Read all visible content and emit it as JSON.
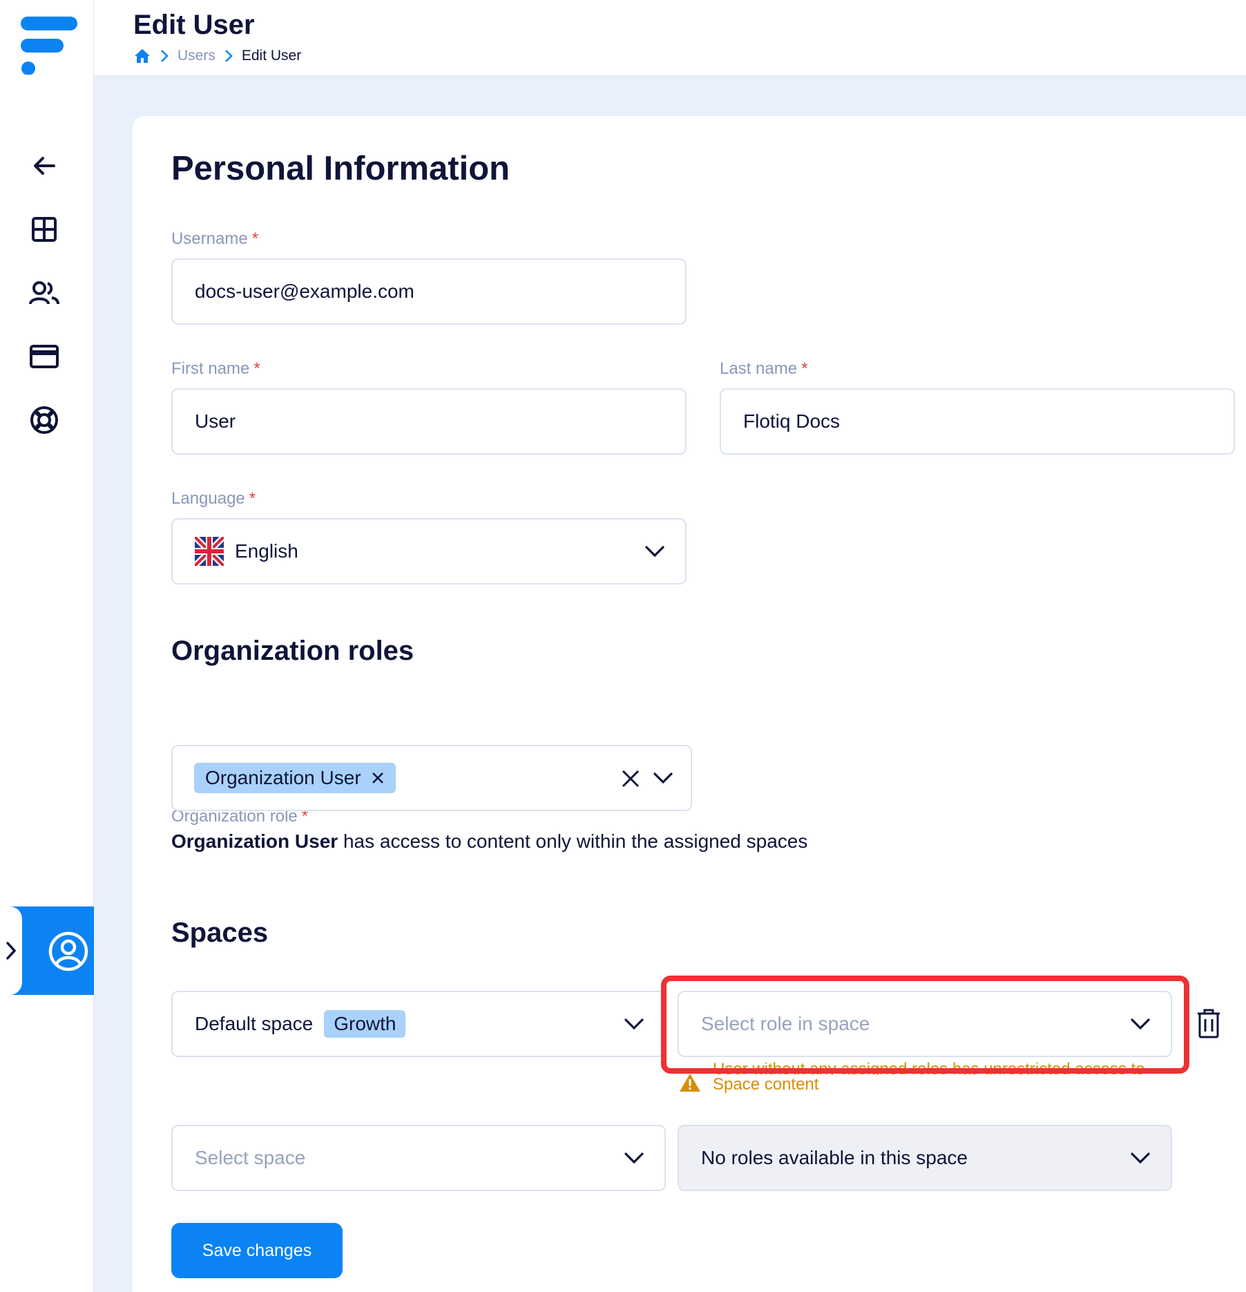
{
  "app": {
    "brand_color": "#0b83f3",
    "heading_color": "#0f1439"
  },
  "sidebar": {
    "items": [
      {
        "icon": "arrow-left-icon"
      },
      {
        "icon": "dashboard-grid-icon"
      },
      {
        "icon": "users-icon"
      },
      {
        "icon": "credit-card-icon"
      },
      {
        "icon": "lifebuoy-icon"
      }
    ],
    "user_menu_icon": "user-circle-icon"
  },
  "header": {
    "title": "Edit User",
    "breadcrumb": {
      "home_icon": "home-icon",
      "items": [
        "Users",
        "Edit User"
      ]
    }
  },
  "personal": {
    "heading": "Personal Information",
    "username": {
      "label": "Username",
      "required": "*",
      "value": "docs-user@example.com"
    },
    "first_name": {
      "label": "First name",
      "required": "*",
      "value": "User"
    },
    "last_name": {
      "label": "Last name",
      "required": "*",
      "value": "Flotiq Docs"
    },
    "language": {
      "label": "Language",
      "required": "*",
      "value": "English",
      "flag_icon": "uk-flag-icon"
    }
  },
  "org_roles": {
    "heading": "Organization roles",
    "role_field": {
      "label": "Organization role",
      "required": "*",
      "selected_tag": "Organization User"
    },
    "description_bold": "Organization User",
    "description_rest": " has access to content only within the assigned spaces"
  },
  "spaces": {
    "heading": "Spaces",
    "rows": [
      {
        "space_name": "Default space",
        "space_plan": "Growth",
        "role_placeholder": "Select role in space"
      },
      {
        "space_placeholder": "Select space",
        "role_value": "No roles available in this space"
      }
    ],
    "warning_line1": "User without any assigned roles has unrestricted access to",
    "warning_line2": "Space content",
    "warning_color": "#d98d00",
    "highlight_color": "#ee3135"
  },
  "actions": {
    "save_label": "Save changes"
  }
}
